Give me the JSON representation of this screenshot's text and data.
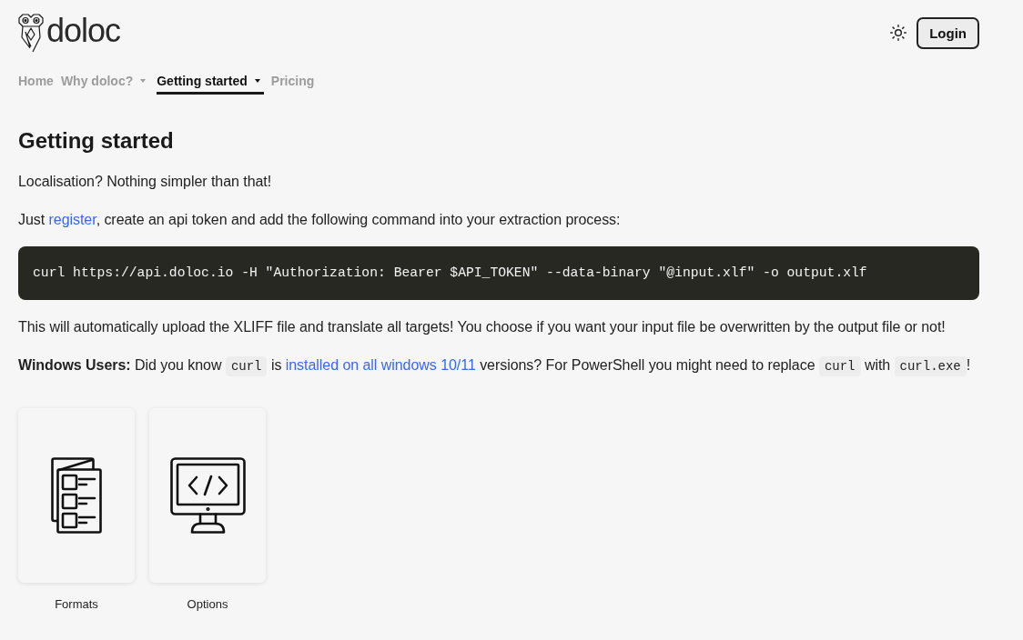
{
  "header": {
    "logo_text": "doloc",
    "login_button": "Login"
  },
  "nav": [
    {
      "label": "Home",
      "selected": false,
      "dropdown": false
    },
    {
      "label": "Why doloc?",
      "selected": false,
      "dropdown": true
    },
    {
      "label": "Getting started",
      "selected": true,
      "dropdown": true
    },
    {
      "label": "Pricing",
      "selected": false,
      "dropdown": false
    }
  ],
  "heading": "Getting started",
  "content": [
    {
      "kind": "paragraph",
      "segments": [
        {
          "kind": "text",
          "text": "Localisation? Nothing simpler than that!"
        }
      ]
    },
    {
      "kind": "paragraph",
      "segments": [
        {
          "kind": "text",
          "text": "Just "
        },
        {
          "kind": "link",
          "text": "register"
        },
        {
          "kind": "text",
          "text": ", create an api token and add the following command into your extraction process:"
        }
      ]
    },
    {
      "kind": "code_block",
      "text": "curl https://api.doloc.io -H \"Authorization: Bearer $API_TOKEN\" --data-binary \"@input.xlf\" -o output.xlf"
    },
    {
      "kind": "paragraph",
      "segments": [
        {
          "kind": "text",
          "text": "This will automatically upload the XLIFF file and translate all targets! You choose if you want your input file be overwritten by the output file or not!"
        }
      ]
    },
    {
      "kind": "paragraph",
      "segments": [
        {
          "kind": "text",
          "text": "**Windows Users:** Did you know "
        },
        {
          "kind": "code",
          "text": "curl"
        },
        {
          "kind": "text",
          "text": " is "
        },
        {
          "kind": "link",
          "text": "installed on all windows 10/11"
        },
        {
          "kind": "text",
          "text": " versions? For PowerShell you might need to replace "
        },
        {
          "kind": "code",
          "text": "curl"
        },
        {
          "kind": "text",
          "text": " with "
        },
        {
          "kind": "code",
          "text": "curl.exe"
        },
        {
          "kind": "text",
          "text": "!"
        }
      ]
    }
  ],
  "tiles": [
    {
      "kind": "checklist",
      "label": "Formats"
    },
    {
      "kind": "code-monitor",
      "label": "Options"
    }
  ]
}
